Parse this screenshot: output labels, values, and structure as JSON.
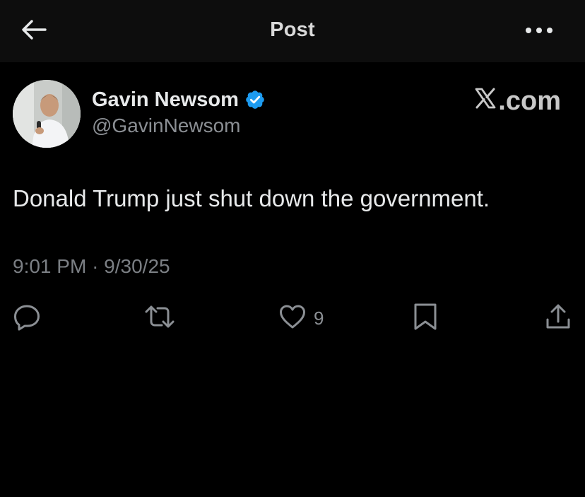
{
  "header": {
    "title": "Post",
    "back_icon": "arrow-left-icon",
    "more_icon": "more-horizontal-icon"
  },
  "post": {
    "author": {
      "display_name": "Gavin Newsom",
      "handle": "@GavinNewsom",
      "verified": true,
      "verified_color": "#1d9bf0"
    },
    "watermark": ".com",
    "text": "Donald Trump just shut down the government.",
    "time": "9:01 PM",
    "separator": "·",
    "date": "9/30/25",
    "actions": {
      "reply": {
        "icon": "reply-icon"
      },
      "repost": {
        "icon": "repost-icon"
      },
      "like": {
        "icon": "heart-icon",
        "count": "9"
      },
      "bookmark": {
        "icon": "bookmark-icon"
      },
      "share": {
        "icon": "share-icon"
      }
    }
  },
  "colors": {
    "background": "#000000",
    "header_background": "#0d0d0d",
    "primary_text": "#e7e9ea",
    "secondary_text": "#8b8f94",
    "accent": "#1d9bf0"
  }
}
